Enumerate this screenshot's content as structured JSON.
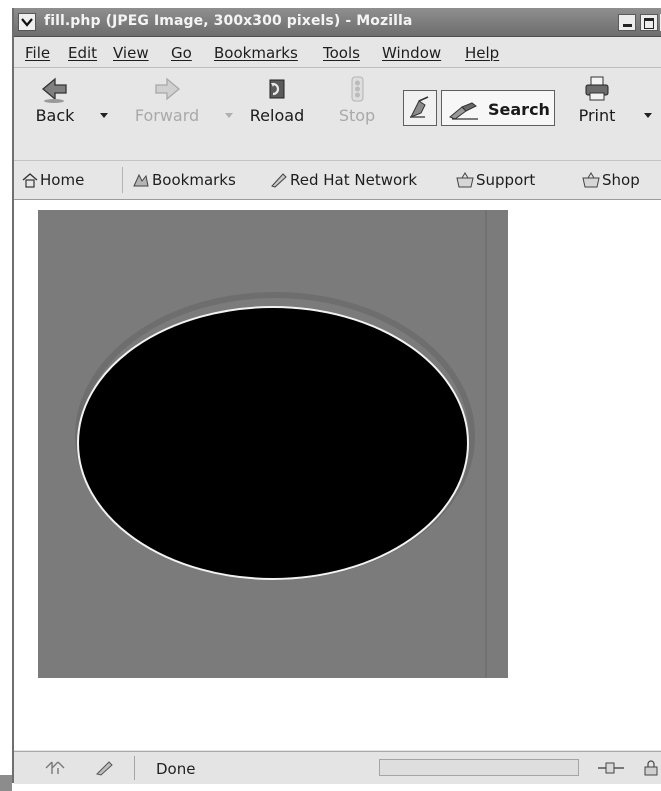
{
  "window": {
    "title": "fill.php (JPEG Image, 300x300 pixels) - Mozilla"
  },
  "menubar": {
    "items": [
      "File",
      "Edit",
      "View",
      "Go",
      "Bookmarks",
      "Tools",
      "Window",
      "Help"
    ]
  },
  "toolbar": {
    "back_label": "Back",
    "forward_label": "Forward",
    "reload_label": "Reload",
    "stop_label": "Stop",
    "search_label": "Search",
    "print_label": "Print"
  },
  "personal_toolbar": {
    "items": [
      "Home",
      "Bookmarks",
      "Red Hat Network",
      "Support",
      "Shop"
    ]
  },
  "status": {
    "text": "Done"
  },
  "colors": {
    "image_background": "#7b7b7b",
    "ellipse_fill": "#000000",
    "ellipse_outline": "#f2f2f2"
  }
}
